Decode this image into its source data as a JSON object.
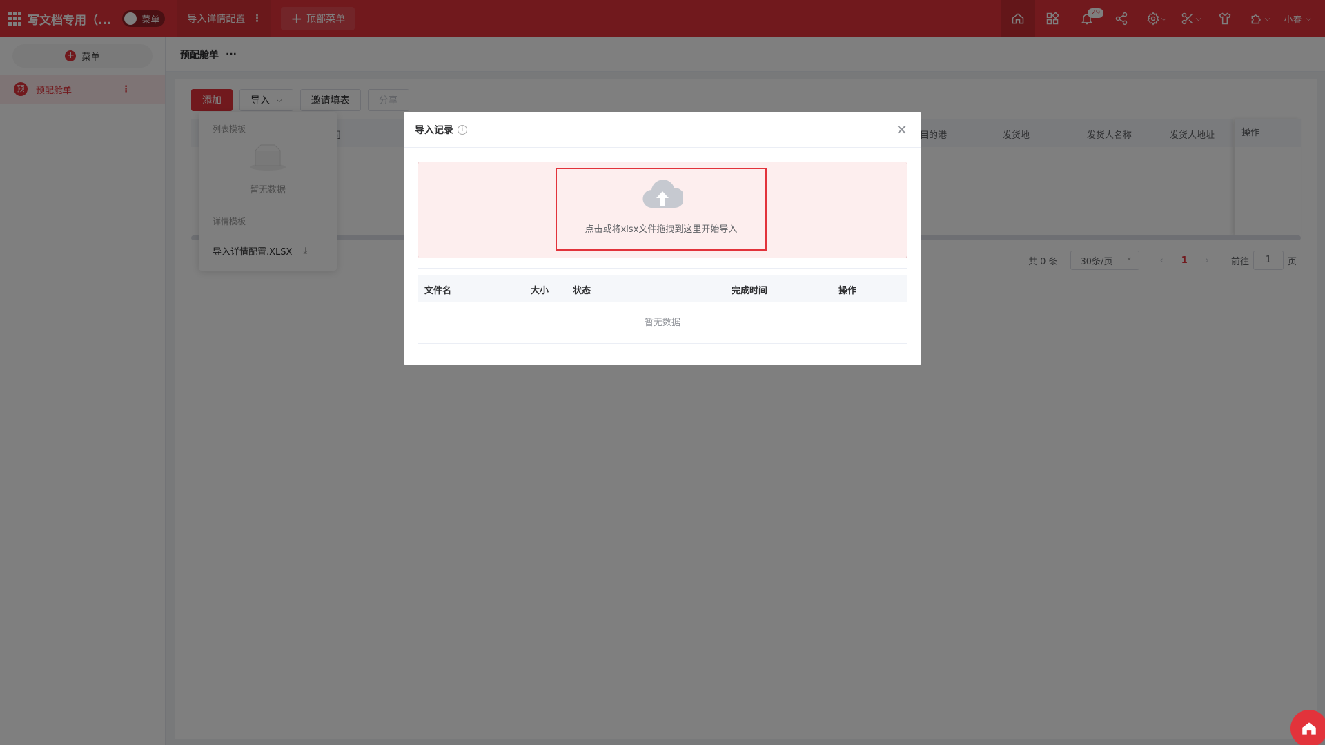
{
  "topbar": {
    "app_title": "写文档专用（...",
    "toggle_label": "菜单",
    "tab_label": "导入详情配置",
    "tab_more": "⋮",
    "add_menu_label": "顶部菜单",
    "notification_count": "29",
    "user_name": "小春"
  },
  "sidebar": {
    "menu_button": "菜单",
    "items": [
      {
        "avatar": "预",
        "label": "预配舱单"
      }
    ]
  },
  "page": {
    "title": "预配舱单",
    "more": "···"
  },
  "toolbar": {
    "add": "添加",
    "import": "导入",
    "invite": "邀请填表",
    "share": "分享"
  },
  "table": {
    "columns_visible": [
      "司",
      "目的港",
      "发货地",
      "发货人名称",
      "发货人地址",
      "操作"
    ]
  },
  "pager": {
    "total": "共 0 条",
    "page_size": "30条/页",
    "prev": "‹",
    "current": "1",
    "next": "›",
    "goto_prefix": "前往",
    "goto_value": "1",
    "goto_suffix": "页"
  },
  "dropdown": {
    "list_template_label": "列表模板",
    "empty_text": "暂无数据",
    "detail_template_label": "详情模板",
    "file_name": "导入详情配置.XLSX"
  },
  "dialog": {
    "title": "导入记录",
    "upload_hint": "点击或将xlsx文件拖拽到这里开始导入",
    "columns": [
      "文件名",
      "大小",
      "状态",
      "完成时间",
      "操作"
    ],
    "empty_text": "暂无数据"
  },
  "colors": {
    "brand": "#e2333b",
    "dropzone_bg": "#fdeeee"
  }
}
